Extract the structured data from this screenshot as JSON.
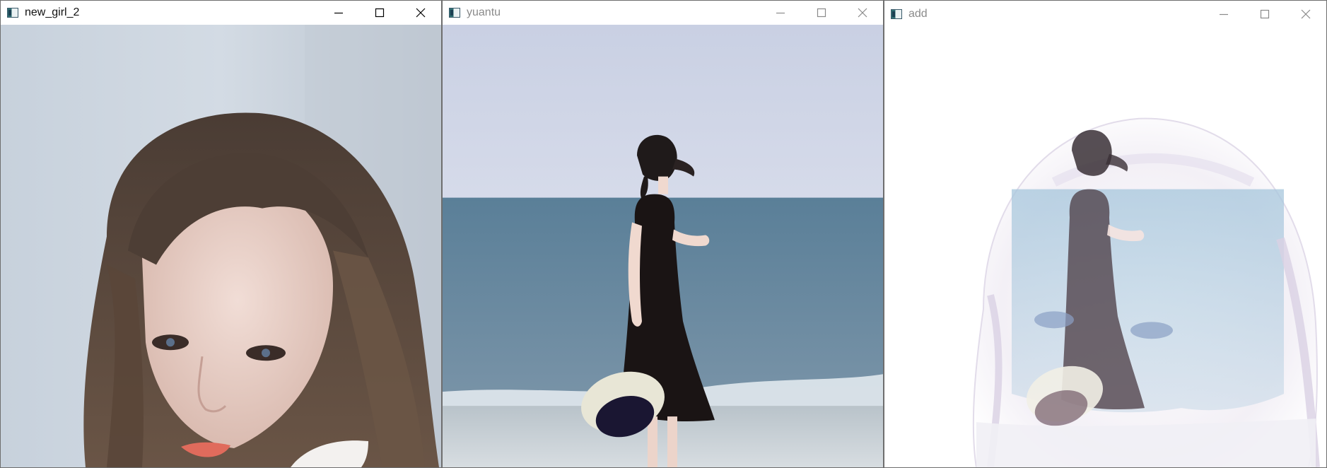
{
  "windows": [
    {
      "title": "new_girl_2",
      "active": true,
      "image_description": "portrait photo"
    },
    {
      "title": "yuantu",
      "active": false,
      "image_description": "beach photo"
    },
    {
      "title": "add",
      "active": false,
      "image_description": "blended photo"
    }
  ],
  "controls": {
    "minimize_icon": "minimize-icon",
    "maximize_icon": "maximize-icon",
    "close_icon": "close-icon"
  },
  "colors": {
    "titlebar_bg": "#ffffff",
    "title_active": "#111111",
    "title_inactive": "#8a8a8a",
    "border": "#6e6e6e",
    "desktop": "#1e1e1e"
  }
}
